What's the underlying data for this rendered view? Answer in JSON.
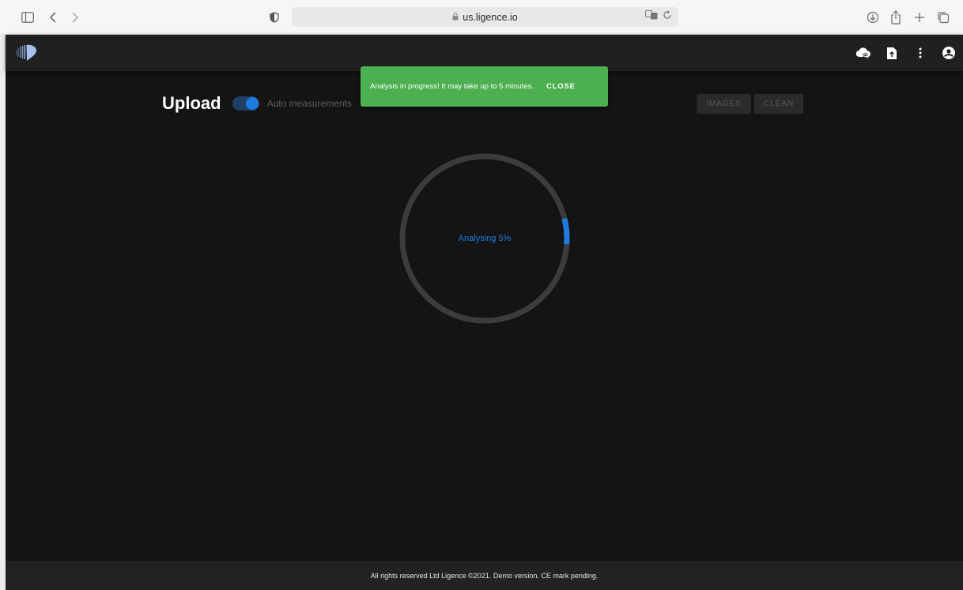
{
  "browser": {
    "url": "us.ligence.io"
  },
  "app": {
    "page_title": "Upload",
    "toggle_label": "Auto measurements",
    "auto_measurements_on": true,
    "snackbar": {
      "message": "Analysis in progress! It may take up to 5 minutes.",
      "close_label": "CLOSE"
    },
    "buttons": {
      "images": "IMAGES",
      "clean": "CLEAN"
    },
    "progress": {
      "label": "Analysing 5%",
      "fraction": 0.05
    },
    "footer": "All rights reserved Ltd Ligence ©2021. Demo version. CE mark pending."
  },
  "colors": {
    "accent": "#1e7be0",
    "snackbar": "#4caf50",
    "background": "#141414"
  }
}
